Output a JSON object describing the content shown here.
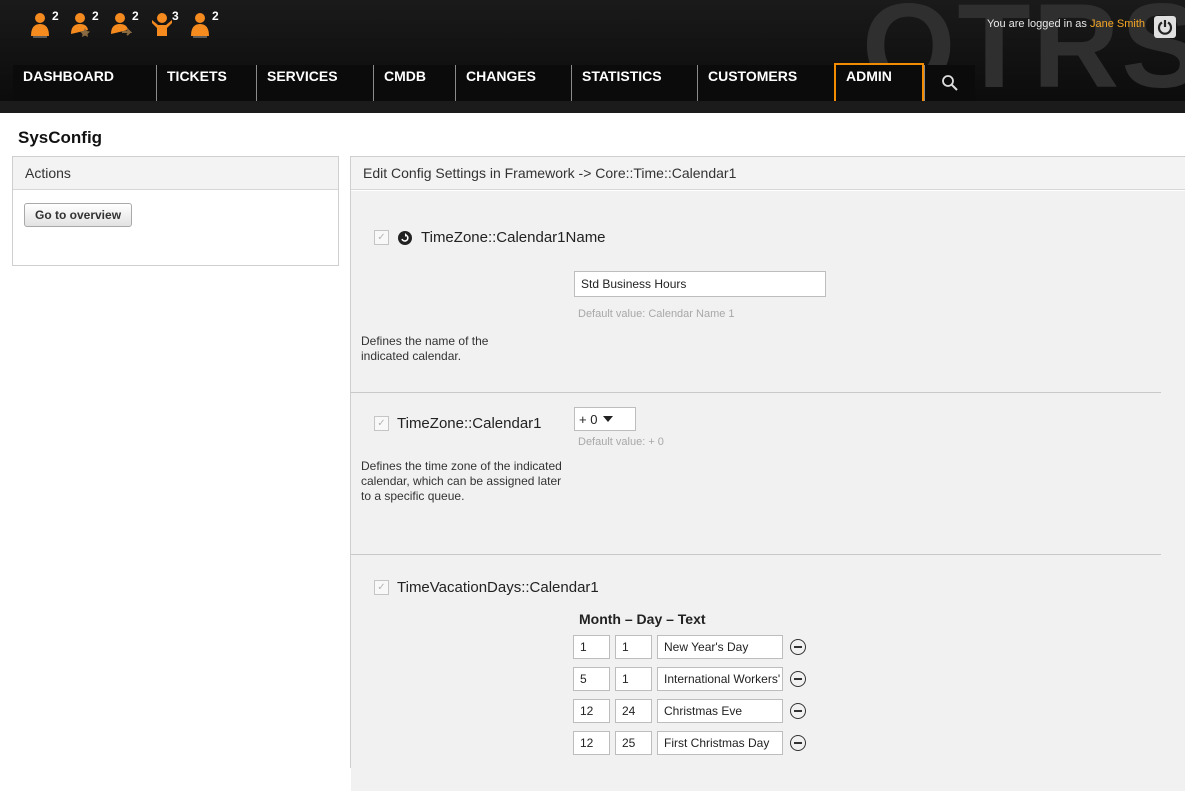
{
  "toolbar": {
    "items": [
      {
        "icon": "user-icon",
        "count": "2"
      },
      {
        "icon": "user-star-icon",
        "count": "2"
      },
      {
        "icon": "user-arrow-icon",
        "count": "2"
      },
      {
        "icon": "user-raised-arms-icon",
        "count": "3"
      },
      {
        "icon": "user-icon",
        "count": "2"
      }
    ]
  },
  "header": {
    "logo_text": "OTRS",
    "login_prefix": "You are logged in as",
    "user_name": "Jane Smith",
    "accent_color": "#f28c00"
  },
  "nav": {
    "items": [
      "DASHBOARD",
      "TICKETS",
      "SERVICES",
      "CMDB",
      "CHANGES",
      "STATISTICS",
      "CUSTOMERS",
      "ADMIN"
    ],
    "active": "ADMIN"
  },
  "page": {
    "title": "SysConfig"
  },
  "sidebar": {
    "title": "Actions",
    "button_label": "Go to overview"
  },
  "main": {
    "title": "Edit Config Settings in Framework -> Core::Time::Calendar1",
    "settings": [
      {
        "name": "TimeZone::Calendar1Name",
        "value": "Std Business Hours",
        "default": "Default value: Calendar Name 1",
        "description": "Defines the name of the indicated calendar."
      },
      {
        "name": "TimeZone::Calendar1",
        "value": "+ 0",
        "default": "Default value: + 0",
        "description": "Defines the time zone of the indicated calendar, which can be assigned later to a specific queue."
      },
      {
        "name": "TimeVacationDays::Calendar1",
        "table_header": "Month – Day – Text",
        "rows": [
          {
            "month": "1",
            "day": "1",
            "text": "New Year's Day"
          },
          {
            "month": "5",
            "day": "1",
            "text": "International Workers' Day"
          },
          {
            "month": "12",
            "day": "24",
            "text": "Christmas Eve"
          },
          {
            "month": "12",
            "day": "25",
            "text": "First Christmas Day"
          }
        ]
      }
    ]
  }
}
